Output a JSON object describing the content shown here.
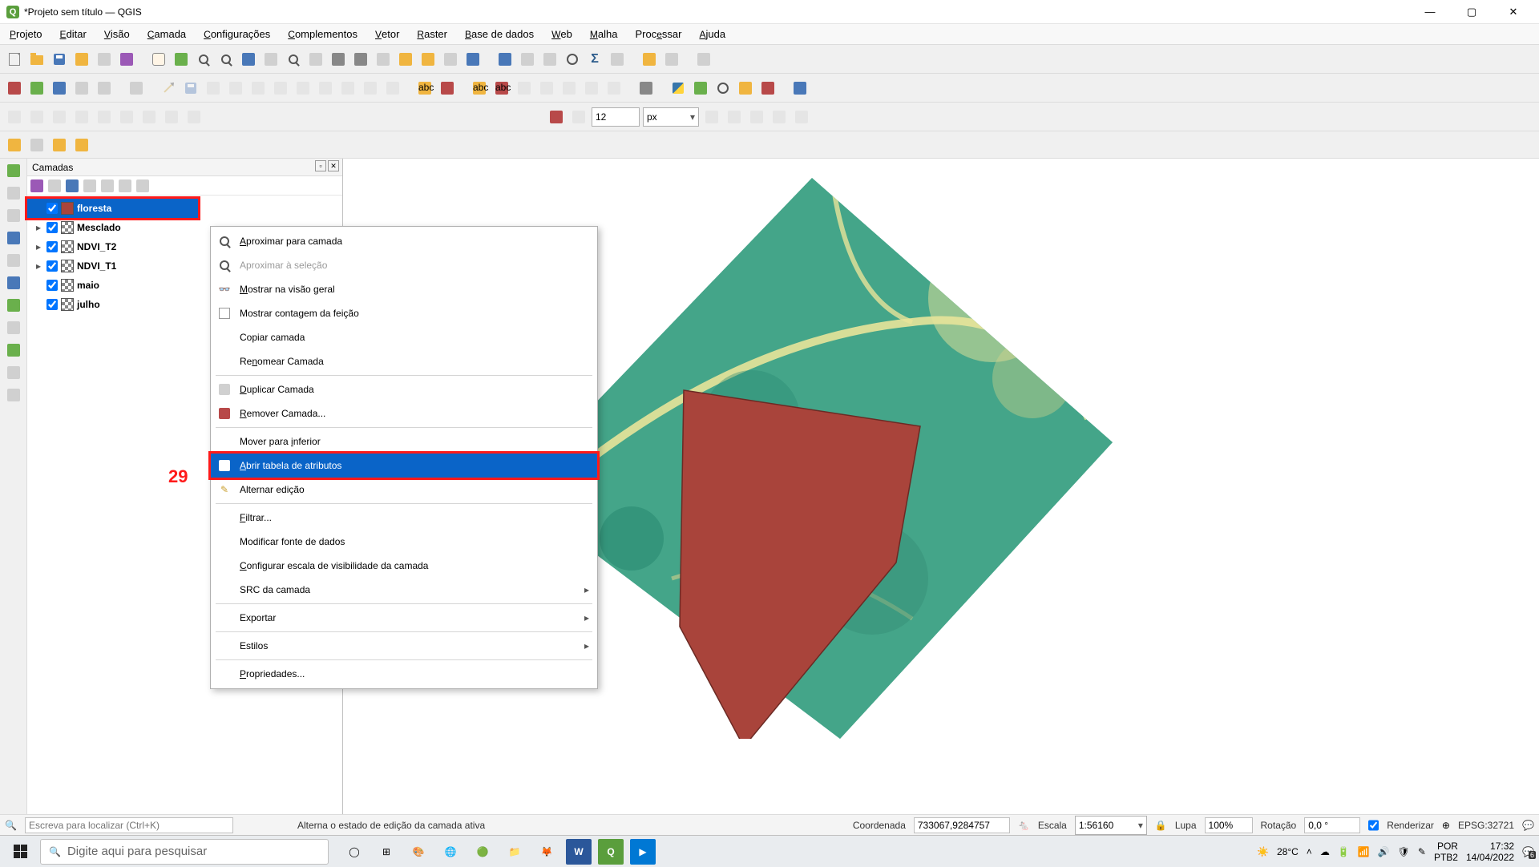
{
  "window": {
    "title": "*Projeto sem título — QGIS"
  },
  "menu": [
    "Projeto",
    "Editar",
    "Visão",
    "Camada",
    "Configurações",
    "Complementos",
    "Vetor",
    "Raster",
    "Base de dados",
    "Web",
    "Malha",
    "Processar",
    "Ajuda"
  ],
  "menu_underline_idx": [
    0,
    0,
    0,
    0,
    0,
    0,
    0,
    0,
    0,
    0,
    0,
    4,
    0
  ],
  "snap_value": "12",
  "snap_unit": "px",
  "panels": {
    "layers_title": "Camadas"
  },
  "layers": [
    {
      "name": "floresta",
      "sym": "poly",
      "selected": true,
      "expand": false
    },
    {
      "name": "Mesclado",
      "sym": "raster",
      "selected": false,
      "expand": true
    },
    {
      "name": "NDVI_T2",
      "sym": "raster",
      "selected": false,
      "expand": true
    },
    {
      "name": "NDVI_T1",
      "sym": "raster",
      "selected": false,
      "expand": true
    },
    {
      "name": "maio",
      "sym": "raster",
      "selected": false,
      "expand": false
    },
    {
      "name": "julho",
      "sym": "raster",
      "selected": false,
      "expand": false
    }
  ],
  "context_menu": {
    "items": [
      {
        "icon": "zoom",
        "label": "Aproximar para camada",
        "u": 0
      },
      {
        "icon": "zoom",
        "label": "Aproximar à seleção",
        "disabled": true
      },
      {
        "icon": "eye",
        "label": "Mostrar na visão geral",
        "u": 0
      },
      {
        "icon": "check",
        "label": "Mostrar contagem da feição"
      },
      {
        "icon": "",
        "label": "Copiar camada"
      },
      {
        "icon": "",
        "label": "Renomear Camada",
        "u": 2
      },
      {
        "sep": true
      },
      {
        "icon": "copy",
        "label": "Duplicar Camada",
        "u": 0
      },
      {
        "icon": "remove",
        "label": "Remover Camada...",
        "u": 0
      },
      {
        "sep": true
      },
      {
        "icon": "",
        "label": "Mover para _inferior"
      },
      {
        "icon": "table",
        "label": "Abrir tabela de atributos",
        "hover": true,
        "hl": true,
        "u": 0
      },
      {
        "icon": "pencil",
        "label": "Alternar edição"
      },
      {
        "sep": true
      },
      {
        "icon": "",
        "label": "Filtrar...",
        "u": 0
      },
      {
        "icon": "",
        "label": "Modificar fonte de dados"
      },
      {
        "icon": "",
        "label": "Configurar escala de visibilidade da camada",
        "u": 0
      },
      {
        "icon": "",
        "label": "SRC da camada",
        "sub": true
      },
      {
        "sep": true
      },
      {
        "icon": "",
        "label": "Exportar",
        "sub": true
      },
      {
        "sep": true
      },
      {
        "icon": "",
        "label": "Estilos",
        "sub": true
      },
      {
        "sep": true
      },
      {
        "icon": "",
        "label": "Propriedades...",
        "u": 0
      }
    ]
  },
  "annotation": "29",
  "status_hint": "Alterna o estado de edição da camada ativa",
  "status": {
    "locator_ph": "Escreva para localizar (Ctrl+K)",
    "coord_lbl": "Coordenada",
    "coord": "733067,9284757",
    "scale_lbl": "Escala",
    "scale": "1:56160",
    "mag_lbl": "Lupa",
    "mag": "100%",
    "rot_lbl": "Rotação",
    "rot": "0,0 °",
    "render_lbl": "Renderizar",
    "crs": "EPSG:32721"
  },
  "taskbar": {
    "search_ph": "Digite aqui para pesquisar",
    "weather": "28°C",
    "lang1": "POR",
    "lang2": "PTB2",
    "time": "17:32",
    "date": "14/04/2022",
    "notif": "6"
  }
}
